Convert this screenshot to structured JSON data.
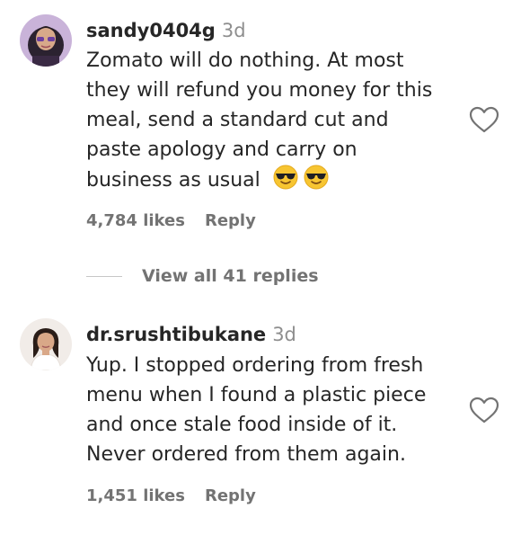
{
  "comments": [
    {
      "username": "sandy0404g",
      "time": "3d",
      "lines": [
        "Zomato will do nothing. At most",
        "they will refund you money for this",
        "meal, send a standard cut and",
        "paste apology and carry on",
        "business as usual"
      ],
      "emojis": [
        "smiling-face-with-sunglasses-icon",
        "smiling-face-with-sunglasses-icon"
      ],
      "likes": "4,784 likes",
      "reply_label": "Reply"
    },
    {
      "username": "dr.srushtibukane",
      "time": "3d",
      "lines": [
        "Yup. I stopped ordering from fresh",
        "menu when I found a plastic piece",
        "and once stale food inside of it.",
        "Never ordered from them again."
      ],
      "likes": "1,451 likes",
      "reply_label": "Reply"
    }
  ],
  "view_replies": "View all 41 replies",
  "colors": {
    "text": "#262626",
    "muted": "#737373",
    "timestamp": "#8e8e8e",
    "divider": "#c7c7c7"
  }
}
